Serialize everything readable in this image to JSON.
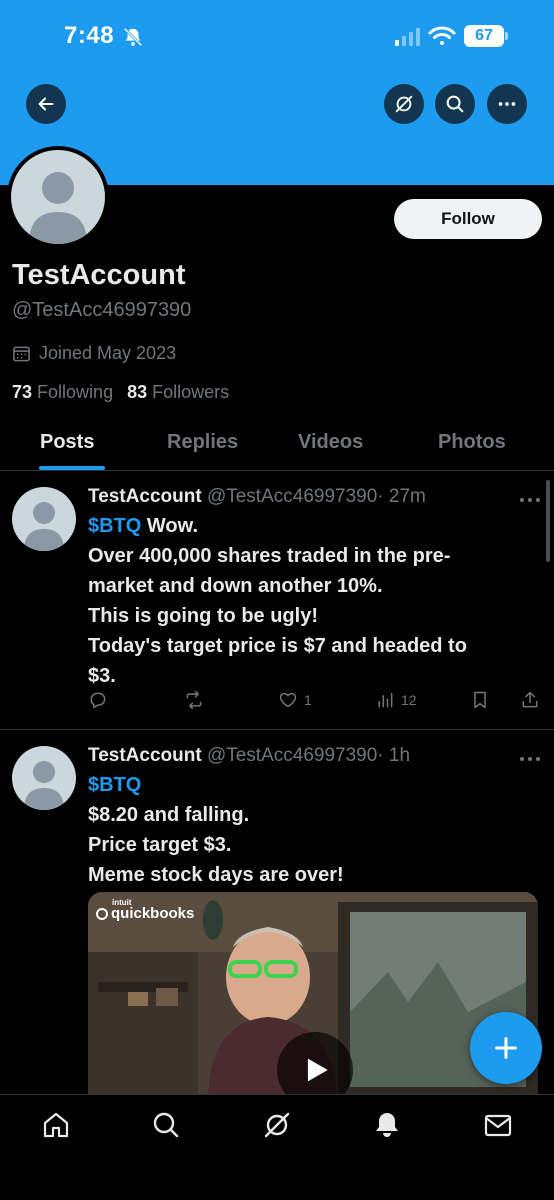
{
  "status_bar": {
    "time": "7:48",
    "battery": "67"
  },
  "profile": {
    "display_name": "TestAccount",
    "handle": "@TestAcc46997390",
    "joined": "Joined May 2023",
    "following_count": "73",
    "following_label": "Following",
    "followers_count": "83",
    "followers_label": "Followers",
    "follow_label": "Follow"
  },
  "tabs": [
    {
      "label": "Posts",
      "active": true
    },
    {
      "label": "Replies",
      "active": false
    },
    {
      "label": "Videos",
      "active": false
    },
    {
      "label": "Photos",
      "active": false
    }
  ],
  "posts": [
    {
      "name": "TestAccount",
      "handle": "@TestAcc46997390",
      "time": "· 27m",
      "cashtag": "$BTQ",
      "lines": [
        "Wow.",
        "Over 400,000 shares traded in the pre-",
        "market and down another 10%.",
        "This is going to be ugly!",
        "Today's target price is $7 and headed to",
        "$3."
      ],
      "likes": "1",
      "views": "12"
    },
    {
      "name": "TestAccount",
      "handle": "@TestAcc46997390",
      "time": "· 1h",
      "cashtag": "$BTQ",
      "lines": [
        "$8.20 and falling.",
        "Price target $3.",
        "Meme stock days are over!"
      ],
      "media_watermark": "quickbooks",
      "media_watermark_small": "intuit"
    }
  ],
  "colors": {
    "accent": "#1d9bf0",
    "background": "#000000",
    "muted": "#71767b",
    "text": "#e7e9ea"
  },
  "icons": {
    "back": "arrow-left-icon",
    "grok": "grok-icon",
    "search": "search-icon",
    "more": "more-icon",
    "calendar": "calendar-icon",
    "reply": "reply-icon",
    "repost": "repost-icon",
    "like": "heart-icon",
    "views": "views-icon",
    "bookmark": "bookmark-icon",
    "share": "share-icon",
    "compose": "plus-icon",
    "nav": [
      "home-icon",
      "search-icon",
      "grok-icon",
      "bell-icon",
      "mail-icon"
    ]
  }
}
